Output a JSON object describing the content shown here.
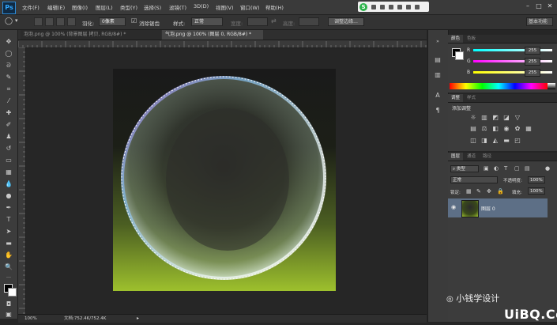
{
  "app": {
    "logo": "Ps"
  },
  "menu": [
    "文件(F)",
    "编辑(E)",
    "图像(I)",
    "图层(L)",
    "类型(Y)",
    "选择(S)",
    "滤镜(T)",
    "3D(D)",
    "视图(V)",
    "窗口(W)",
    "帮助(H)"
  ],
  "options": {
    "feather_label": "羽化:",
    "feather_value": "0像素",
    "antialias_label": "消除锯齿",
    "style_label": "样式:",
    "style_value": "正常",
    "width_label": "宽度:",
    "height_label": "高度:",
    "refine_edge": "调整边缘...",
    "workspace": "基本功能"
  },
  "tabs": [
    {
      "label": "泡泡.png @ 100% (背景图层 拷贝, RGB/8#) *"
    },
    {
      "label": "气泡.png @ 100% (图层 0, RGB/8#) *"
    }
  ],
  "status": {
    "zoom": "100%",
    "doc": "文档:752.4K/752.4K"
  },
  "color_panel": {
    "tabs": [
      "颜色",
      "色板"
    ],
    "r_label": "R",
    "g_label": "G",
    "b_label": "B",
    "r": "255",
    "g": "255",
    "b": "255"
  },
  "adjust_panel": {
    "tabs": [
      "调整",
      "样式"
    ],
    "title": "添加调整"
  },
  "layers_panel": {
    "tabs": [
      "图层",
      "通道",
      "路径"
    ],
    "filter_kind": "类型",
    "blend_mode": "正常",
    "opacity_label": "不透明度:",
    "opacity_value": "100%",
    "lock_label": "锁定:",
    "fill_label": "填充:",
    "fill_value": "100%",
    "layer_name": "图层 0"
  },
  "watermark": {
    "line1": "小钱学设计",
    "line2": "UiBQ.CoM"
  },
  "colors": {
    "selection": "#5d6f86",
    "accent_blue": "#31a8ff",
    "image_green": "#9dc02d"
  }
}
